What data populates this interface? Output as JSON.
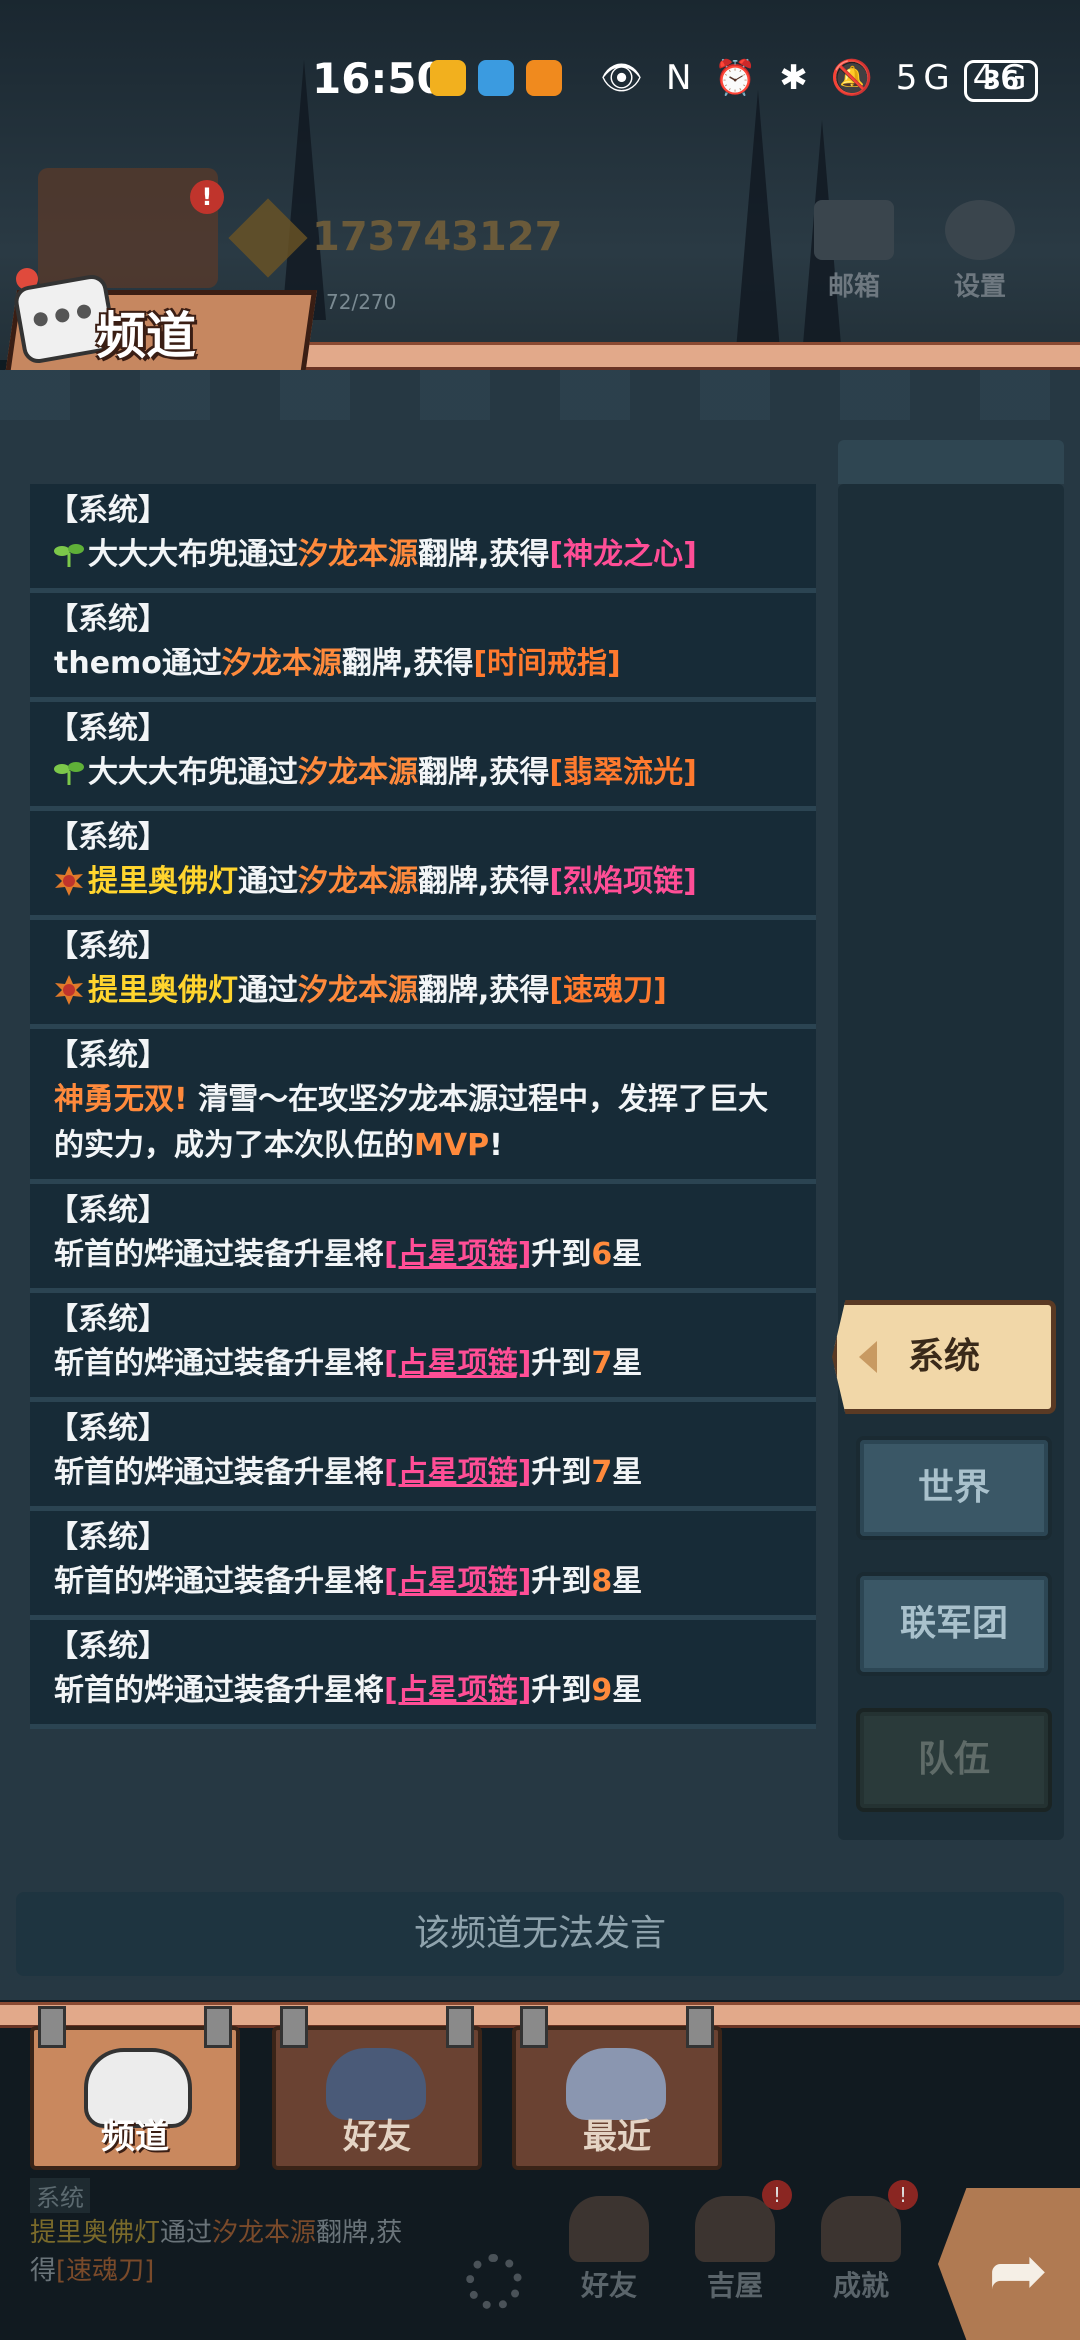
{
  "status_bar": {
    "time": "16:50",
    "icons": "👁 N ⏰ ✱ 🔕 5G 4G",
    "battery": "36"
  },
  "header": {
    "power": "173743127",
    "stamina": "72/270",
    "avatar_badge": "!",
    "mail_label": "邮箱",
    "settings_label": "设置"
  },
  "banner": {
    "title": "频道"
  },
  "messages": [
    {
      "tag": "【系统】",
      "icon": "sprout",
      "player": "大大大布兜",
      "pre": "通过",
      "dungeon": "汐龙本源",
      "mid": "翻牌,获得",
      "item": "[神龙之心]"
    },
    {
      "tag": "【系统】",
      "icon": "",
      "player": "themo",
      "pre": "通过",
      "dungeon": "汐龙本源",
      "mid": "翻牌,获得",
      "item": "[时间戒指]"
    },
    {
      "tag": "【系统】",
      "icon": "sprout",
      "player": "大大大布兜",
      "pre": "通过",
      "dungeon": "汐龙本源",
      "mid": "翻牌,获得",
      "item": "[翡翠流光]"
    },
    {
      "tag": "【系统】",
      "icon": "sun",
      "player": "提里奥佛灯",
      "pre": "通过",
      "dungeon": "汐龙本源",
      "mid": "翻牌,获得",
      "item": "[烈焰项链]"
    },
    {
      "tag": "【系统】",
      "icon": "sun",
      "player": "提里奥佛灯",
      "pre": "通过",
      "dungeon": "汐龙本源",
      "mid": "翻牌,获得",
      "item": "[速魂刀]"
    },
    {
      "tag": "【系统】",
      "mvp_lead": "神勇无双!",
      "mvp_text_1": " 清雪～在攻坚汐龙本源过程中，发挥了巨大的实力，成为了本次队伍的",
      "mvp_word": "MVP",
      "mvp_end": "!"
    },
    {
      "tag": "【系统】",
      "player": "斩首的烨",
      "pre": "通过装备升星将",
      "item": "[占星项链]",
      "mid": "升到",
      "level": "6",
      "suffix": "星"
    },
    {
      "tag": "【系统】",
      "player": "斩首的烨",
      "pre": "通过装备升星将",
      "item": "[占星项链]",
      "mid": "升到",
      "level": "7",
      "suffix": "星"
    },
    {
      "tag": "【系统】",
      "player": "斩首的烨",
      "pre": "通过装备升星将",
      "item": "[占星项链]",
      "mid": "升到",
      "level": "7",
      "suffix": "星"
    },
    {
      "tag": "【系统】",
      "player": "斩首的烨",
      "pre": "通过装备升星将",
      "item": "[占星项链]",
      "mid": "升到",
      "level": "8",
      "suffix": "星"
    },
    {
      "tag": "【系统】",
      "player": "斩首的烨",
      "pre": "通过装备升星将",
      "item": "[占星项链]",
      "mid": "升到",
      "level": "9",
      "suffix": "星"
    }
  ],
  "channels": {
    "system": "系统",
    "world": "世界",
    "legion": "联军团",
    "team": "队伍"
  },
  "input": {
    "disabled_text": "该频道无法发言"
  },
  "bottom_tabs": {
    "channel": "频道",
    "friends": "好友",
    "recent": "最近"
  },
  "mini_chat": {
    "tag": "系统",
    "player": "提里奥佛灯",
    "pre": "通过",
    "dungeon": "汐龙本源",
    "mid": "翻牌,获",
    "line2_pre": "得",
    "item": "[速魂刀]"
  },
  "bottom_nav": {
    "friends": "好友",
    "house": "吉屋",
    "achievements": "成就",
    "badge": "!"
  },
  "colors": {
    "dungeon": "#ff8a3c",
    "item_pink": "#ff4e96",
    "player_gold": "#ffd52e"
  }
}
